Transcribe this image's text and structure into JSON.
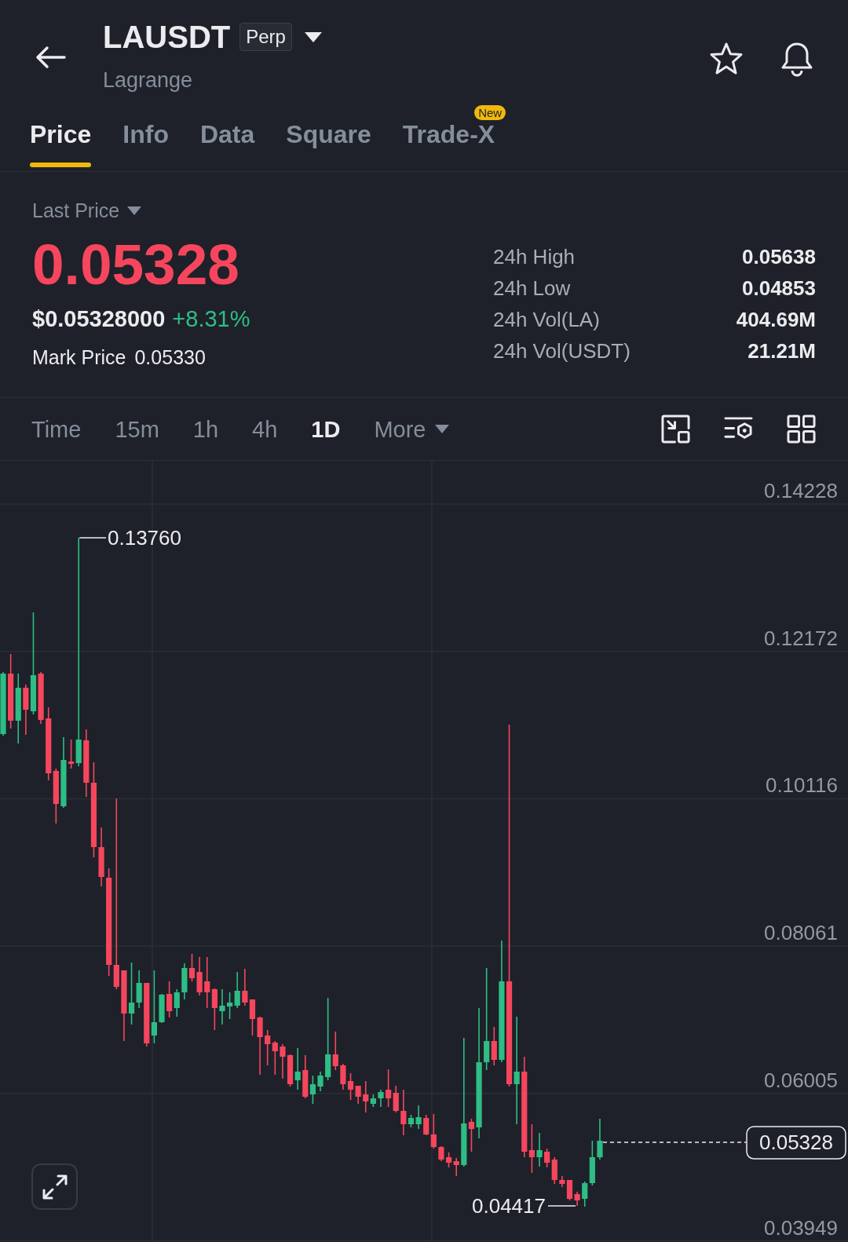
{
  "header": {
    "symbol": "LAUSDT",
    "contract_badge": "Perp",
    "subtitle": "Lagrange"
  },
  "tabs": [
    {
      "label": "Price",
      "selected": true
    },
    {
      "label": "Info",
      "selected": false
    },
    {
      "label": "Data",
      "selected": false
    },
    {
      "label": "Square",
      "selected": false
    },
    {
      "label": "Trade-X",
      "selected": false,
      "badge": "New"
    }
  ],
  "price": {
    "selector": "Last Price",
    "last": "0.05328",
    "usd": "$0.05328000",
    "change": "+8.31%",
    "mark_label": "Mark Price",
    "mark_value": "0.05330"
  },
  "stats": [
    {
      "label": "24h High",
      "value": "0.05638"
    },
    {
      "label": "24h Low",
      "value": "0.04853"
    },
    {
      "label": "24h Vol(LA)",
      "value": "404.69M"
    },
    {
      "label": "24h Vol(USDT)",
      "value": "21.21M"
    }
  ],
  "intervals": [
    {
      "label": "Time",
      "kind": "option",
      "selected": false
    },
    {
      "label": "15m",
      "kind": "option",
      "selected": false
    },
    {
      "label": "1h",
      "kind": "option",
      "selected": false
    },
    {
      "label": "4h",
      "kind": "option",
      "selected": false
    },
    {
      "label": "1D",
      "kind": "option",
      "selected": true
    },
    {
      "label": "More",
      "kind": "menu",
      "selected": false
    }
  ],
  "chart": {
    "price_labels": [
      "0.14228",
      "0.12172",
      "0.10116",
      "0.08061",
      "0.06005",
      "0.03949"
    ],
    "high_marker": "0.13760",
    "low_marker": "0.04417",
    "last_price_tag": "0.05328"
  }
}
